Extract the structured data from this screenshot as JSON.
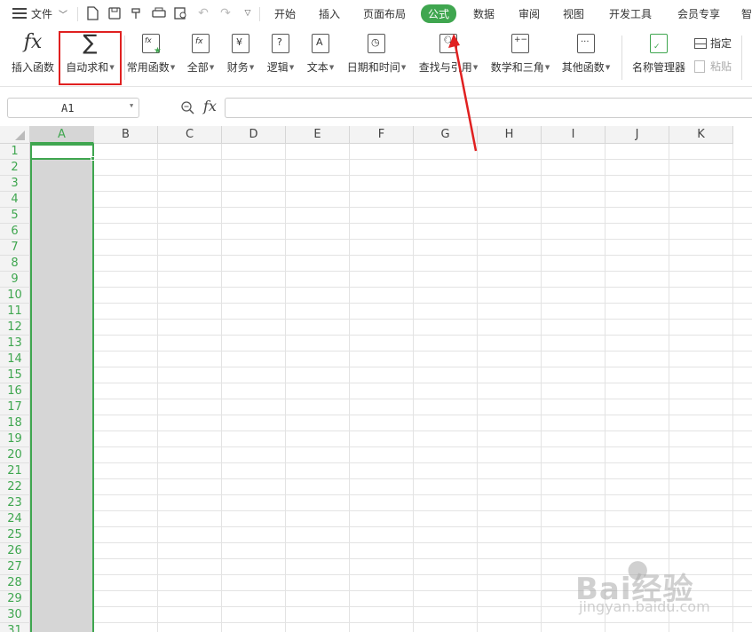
{
  "menubar": {
    "file_label": "文件",
    "tabs": [
      {
        "label": "开始"
      },
      {
        "label": "插入"
      },
      {
        "label": "页面布局"
      },
      {
        "label": "公式",
        "active": true
      },
      {
        "label": "数据"
      },
      {
        "label": "审阅"
      },
      {
        "label": "视图"
      },
      {
        "label": "开发工具"
      },
      {
        "label": "会员专享"
      },
      {
        "label": "智"
      }
    ]
  },
  "ribbon": {
    "insert_function": "插入函数",
    "autosum": "自动求和",
    "common_functions": "常用函数",
    "all": "全部",
    "finance": "财务",
    "logic": "逻辑",
    "text": "文本",
    "datetime": "日期和时间",
    "lookup": "查找与引用",
    "math": "数学和三角",
    "other": "其他函数",
    "name_manager": "名称管理器",
    "specify": "指定",
    "paste": "粘贴",
    "fx_glyph": "fx",
    "sigma_glyph": "∑"
  },
  "formula_bar": {
    "cell_ref": "A1",
    "fx_glyph": "fx",
    "value": ""
  },
  "grid": {
    "columns": [
      "A",
      "B",
      "C",
      "D",
      "E",
      "F",
      "G",
      "H",
      "I",
      "J",
      "K"
    ],
    "rows": [
      "1",
      "2",
      "3",
      "4",
      "5",
      "6",
      "7",
      "8",
      "9",
      "10",
      "11",
      "12",
      "13",
      "14",
      "15",
      "16",
      "17",
      "18",
      "19",
      "20",
      "21",
      "22",
      "23",
      "24",
      "25",
      "26",
      "27",
      "28",
      "29",
      "30",
      "31"
    ],
    "selected_column": "A"
  },
  "watermark": {
    "brand": "Bai经验",
    "url": "jingyan.baidu.com"
  },
  "colors": {
    "accent": "#3fa64f",
    "annotation": "#e02020"
  }
}
